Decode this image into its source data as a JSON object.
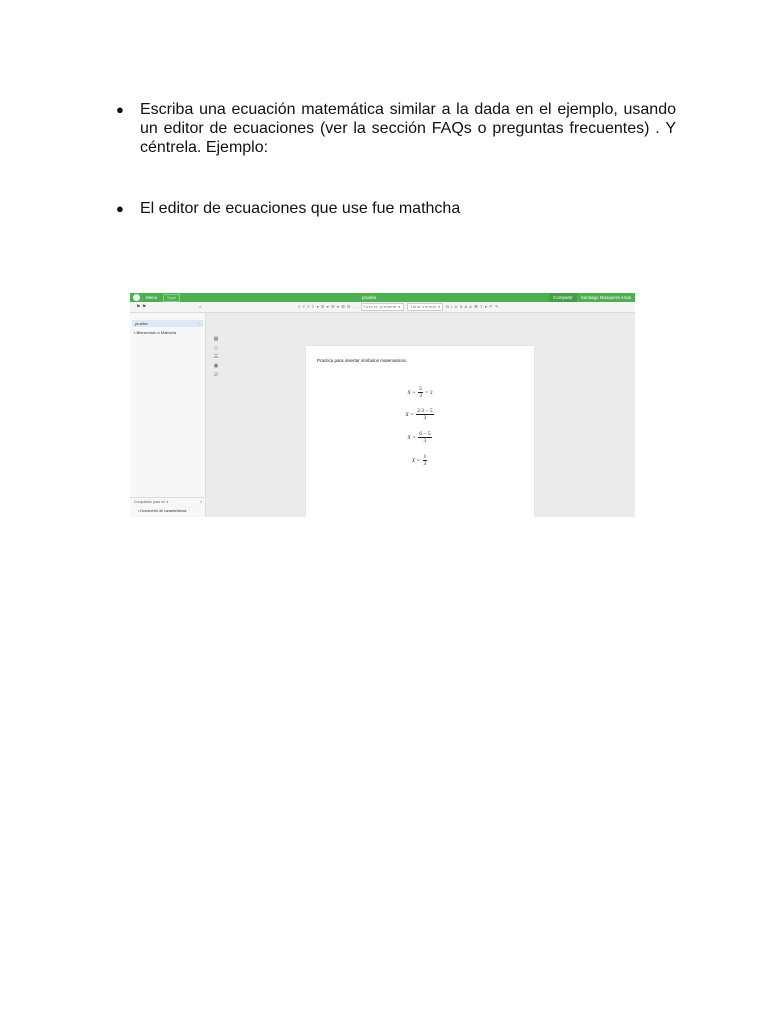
{
  "document": {
    "bullets": [
      {
        "marker": "●",
        "text": "Escriba una ecuación matemática similar a la dada en el ejemplo, usando un editor de ecuaciones (ver la sección FAQs o preguntas frecuentes) . Y céntrela. Ejemplo:"
      },
      {
        "marker": "●",
        "text": "El editor de ecuaciones que use fue mathcha"
      }
    ]
  },
  "screenshot": {
    "topbar": {
      "menu_label": "Menu",
      "save_label": "Save",
      "doc_title": "prueba",
      "share_label": "Compartir",
      "user_label": "Santiago Mosquera Arias"
    },
    "toolbar": {
      "tools_text": "≡ ≡ ≡ ≡ ▾ ☰ ▾ ☰ ▾ ⊞ ⊟ ...",
      "font_select": "Fuente prederm ▾",
      "size_select": "Talla normal ▾",
      "format_text": "B I U S  A A  ⌘  T ▾  ↶ ↷"
    },
    "sidebar": {
      "items": [
        {
          "label": "prueba",
          "active": true
        },
        {
          "label": "Bienvenido a Mathcha",
          "active": false
        }
      ],
      "shared_label": "Compartido para mi",
      "shared_doc": "Documento de caracteristicas"
    },
    "page": {
      "text": "Practica para insertar símbolos matematicos.",
      "equations": [
        {
          "lhs": "X + ",
          "num": "5",
          "den": "3",
          "rhs": " = 2"
        },
        {
          "lhs": "X = ",
          "num": "2.3 − 5",
          "den": "3",
          "rhs": ""
        },
        {
          "lhs": "X = ",
          "num": "6 − 5",
          "den": "3",
          "rhs": ""
        },
        {
          "lhs": "X = ",
          "num": "1",
          "den": "3",
          "rhs": ""
        }
      ]
    },
    "colors": {
      "accent": "#4caf50"
    }
  }
}
